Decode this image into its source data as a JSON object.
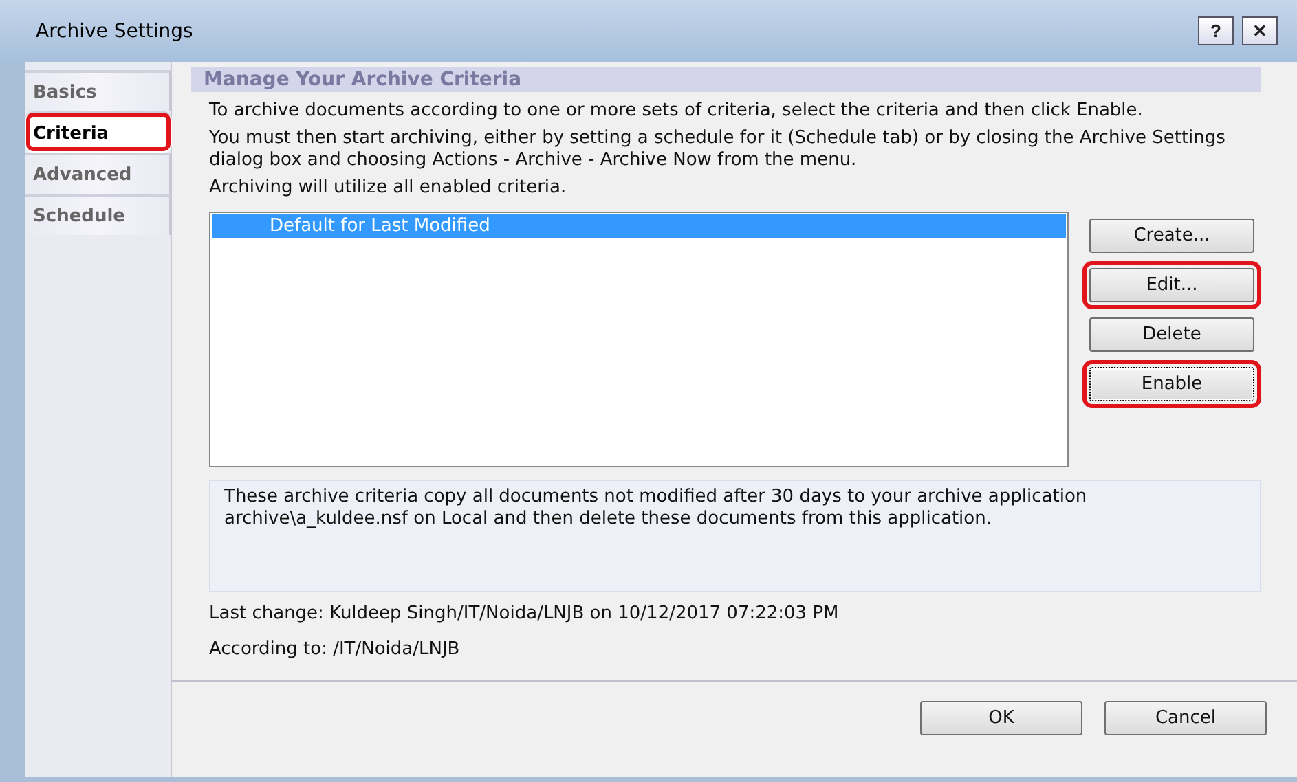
{
  "window": {
    "title": "Archive Settings",
    "buttons": [
      "?",
      "✕"
    ]
  },
  "tabs": [
    {
      "label": "Basics",
      "selected": false,
      "highlighted": false
    },
    {
      "label": "Criteria",
      "selected": true,
      "highlighted": true
    },
    {
      "label": "Advanced",
      "selected": false,
      "highlighted": false
    },
    {
      "label": "Schedule",
      "selected": false,
      "highlighted": false
    }
  ],
  "section_title": "Manage Your Archive Criteria",
  "paragraphs": [
    "To archive documents according to one or more sets of criteria, select the criteria and then click Enable.",
    "You must then start archiving, either by setting a schedule for it (Schedule tab) or by closing the Archive Settings dialog box and choosing Actions - Archive - Archive Now from the menu.",
    "Archiving will utilize all enabled criteria."
  ],
  "criteria_list": [
    {
      "label": "Default for Last Modified",
      "selected": true
    }
  ],
  "side_buttons": [
    {
      "label": "Create...",
      "highlighted": false,
      "focused": false
    },
    {
      "label": "Edit...",
      "highlighted": true,
      "focused": false
    },
    {
      "label": "Delete",
      "highlighted": false,
      "focused": false
    },
    {
      "label": "Enable",
      "highlighted": true,
      "focused": true
    }
  ],
  "description": "These archive criteria copy all documents not modified after 30 days to your archive application archive\\a_kuldee.nsf on Local and then delete these documents from this application.",
  "last_change": "Last change: Kuldeep Singh/IT/Noida/LNJB on 10/12/2017 07:22:03 PM",
  "according_to": "According to: /IT/Noida/LNJB",
  "dialog_buttons": [
    "OK",
    "Cancel"
  ]
}
